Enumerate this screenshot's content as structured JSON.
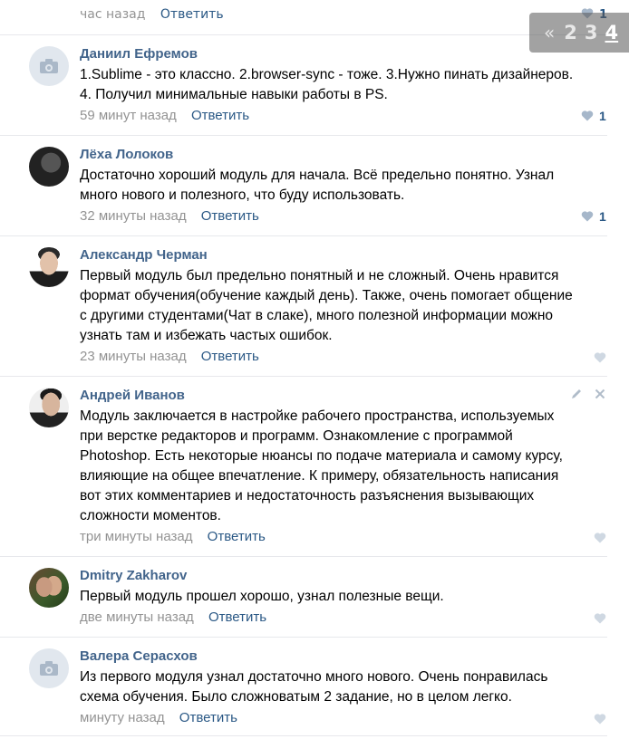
{
  "top": {
    "time": "час назад",
    "reply_label": "Ответить",
    "likes": "1"
  },
  "pager": {
    "prev": "«",
    "pages": [
      "2",
      "3",
      "4"
    ],
    "current": "4"
  },
  "comments": [
    {
      "author": "Даниил Ефремов",
      "avatar": "camera-placeholder",
      "text": "1.Sublime - это классно. 2.browser-sync - тоже. 3.Нужно пинать дизайнеров.\n4. Получил минимальные навыки работы в PS.",
      "time": "59 минут назад",
      "reply_label": "Ответить",
      "likes": "1"
    },
    {
      "author": "Лёха Лолоков",
      "avatar": "photo",
      "text": "Достаточно хороший модуль для начала. Всё предельно понятно. Узнал\nмного нового и полезного, что буду использовать.",
      "time": "32 минуты назад",
      "reply_label": "Ответить",
      "likes": "1"
    },
    {
      "author": "Александр Черман",
      "avatar": "photo",
      "text": "Первый модуль был предельно понятный и не сложный. Очень нравится\nформат обучения(обучение каждый день). Также, очень помогает общение\nс другими студентами(Чат в слаке), много полезной информации можно\nузнать там и избежать частых ошибок.",
      "time": "23 минуты назад",
      "reply_label": "Ответить",
      "likes": ""
    },
    {
      "author": "Андрей Иванов",
      "avatar": "photo",
      "text": "Модуль заключается в настройке рабочего пространства, используемых\nпри верстке редакторов и программ. Ознакомление с программой\nPhotoshop. Есть некоторые нюансы по подаче материала и самому курсу,\nвлияющие на общее впечатление. К примеру, обязательность написания\nвот этих комментариев и недостаточность разъяснения вызывающих\nсложности моментов.",
      "time": "три минуты назад",
      "reply_label": "Ответить",
      "likes": ""
    },
    {
      "author": "Dmitry Zakharov",
      "avatar": "photo",
      "text": "Первый модуль прошел хорошо, узнал полезные вещи.",
      "time": "две минуты назад",
      "reply_label": "Ответить",
      "likes": ""
    },
    {
      "author": "Валера Серасхов",
      "avatar": "camera-placeholder",
      "text": "Из первого модуля узнал достаточно много нового. Очень понравилась\nсхема обучения. Было сложноватым 2 задание, но в целом легко.",
      "time": "минуту назад",
      "reply_label": "Ответить",
      "likes": ""
    }
  ],
  "icons": {
    "like": "heart-icon",
    "edit": "pencil-icon",
    "delete": "close-icon"
  },
  "colors": {
    "link": "#2a5885",
    "author": "#42648b",
    "meta": "#939393",
    "heart": "#a6b7ca"
  }
}
